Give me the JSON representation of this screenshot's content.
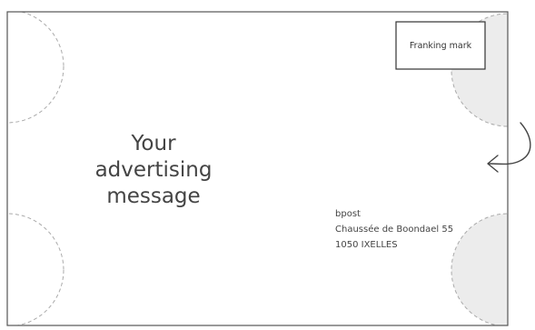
{
  "ad_message": {
    "line1": "Your",
    "line2": "advertising",
    "line3": "message"
  },
  "address": {
    "line1": "bpost",
    "line2": "Chaussée de Boondael 55",
    "line3": "1050 IXELLES"
  },
  "franking": {
    "label": "Franking mark"
  },
  "colors": {
    "envelope_border": "#555555",
    "zone_fill": "#ececec",
    "zone_stroke": "#aaaaaa",
    "arrow": "#444444",
    "text": "#444444"
  },
  "icons": {
    "arrow": "curved-arrow-left-icon"
  }
}
